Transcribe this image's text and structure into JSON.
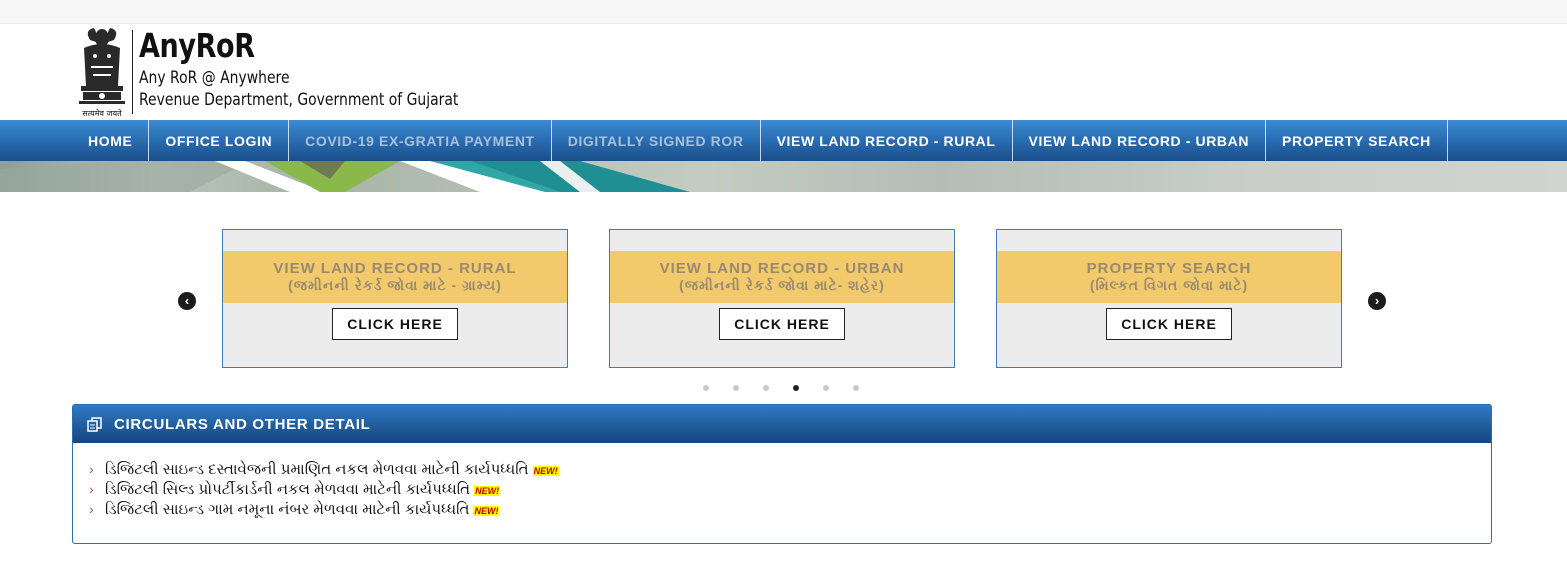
{
  "header": {
    "title": "AnyRoR",
    "subtitle": "Any RoR @ Anywhere",
    "department": "Revenue Department, Government of Gujarat",
    "emblem_caption": "सत्यमेव जयते"
  },
  "nav": {
    "items": [
      {
        "label": "HOME"
      },
      {
        "label": "OFFICE LOGIN"
      },
      {
        "label": "COVID-19 EX-GRATIA PAYMENT"
      },
      {
        "label": "DIGITALLY SIGNED ROR"
      },
      {
        "label": "VIEW LAND RECORD - RURAL"
      },
      {
        "label": "VIEW LAND RECORD - URBAN"
      },
      {
        "label": "PROPERTY SEARCH"
      }
    ]
  },
  "carousel": {
    "prev_icon": "chevron-left-icon",
    "next_icon": "chevron-right-icon",
    "cards": [
      {
        "title": "VIEW LAND RECORD - RURAL",
        "subtitle": "(જમીનની રેકર્ડ જોવા માટે - ગ્રામ્ય)",
        "button": "CLICK HERE"
      },
      {
        "title": "VIEW LAND RECORD - URBAN",
        "subtitle": "(જમીનની રેકર્ડ જોવા માટે- શહેર)",
        "button": "CLICK HERE"
      },
      {
        "title": "PROPERTY SEARCH",
        "subtitle": "(મિલ્કત વિગત જોવા માટે)",
        "button": "CLICK HERE"
      }
    ],
    "dot_count": 6,
    "active_dot": 4
  },
  "circulars": {
    "title": "CIRCULARS AND OTHER DETAIL",
    "badge": "NEW!",
    "items": [
      {
        "text": "ડિજિટલી સાઇન્ડ દસ્તાવેજની પ્રમાણિત નકલ મેળવવા માટેની કાર્યપધ્ધતિ"
      },
      {
        "text": "ડિજિટલી સિલ્ડ પ્રોપર્ટીકાર્ડની નકલ મેળવવા માટેની કાર્યપધ્ધતિ"
      },
      {
        "text": "ડિજિટલી સાઇન્ડ ગામ નમૂના નંબર મેળવવા માટેની કાર્યપધ્ધતિ"
      }
    ]
  },
  "colors": {
    "nav_blue": "#2a6fb5",
    "card_band": "#f2ca6b",
    "card_bg": "#ececec",
    "badge": "#ffff00"
  }
}
